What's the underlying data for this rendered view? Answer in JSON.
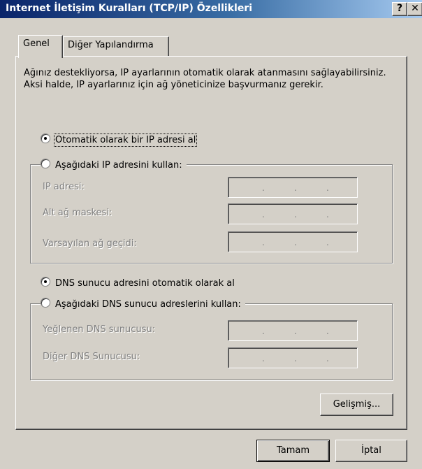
{
  "window": {
    "title": "Internet İletişim Kuralları (TCP/IP) Özellikleri",
    "help_label": "?",
    "close_label": "✕"
  },
  "tabs": [
    {
      "label": "Genel",
      "active": true
    },
    {
      "label": "Diğer Yapılandırma",
      "active": false
    }
  ],
  "description": "Ağınız destekliyorsa, IP ayarlarının otomatik olarak atanmasını sağlayabilirsiniz. Aksi halde, IP ayarlarınız için ağ yöneticinize başvurmanız gerekir.",
  "ip": {
    "auto_label": "Otomatik olarak bir IP adresi al",
    "manual_label": "Aşağıdaki IP adresini kullan:",
    "fields": [
      {
        "label": "IP adresi:"
      },
      {
        "label": "Alt ağ maskesi:"
      },
      {
        "label": "Varsayılan ağ geçidi:"
      }
    ]
  },
  "dns": {
    "auto_label": "DNS sunucu adresini otomatik olarak al",
    "manual_label": "Aşağıdaki DNS sunucu adreslerini kullan:",
    "fields": [
      {
        "label": "Yeğlenen DNS sunucusu:"
      },
      {
        "label": "Diğer DNS Sunucusu:"
      }
    ]
  },
  "advanced_button": "Gelişmiş...",
  "ok_button": "Tamam",
  "cancel_button": "İptal",
  "ip_dot": "."
}
